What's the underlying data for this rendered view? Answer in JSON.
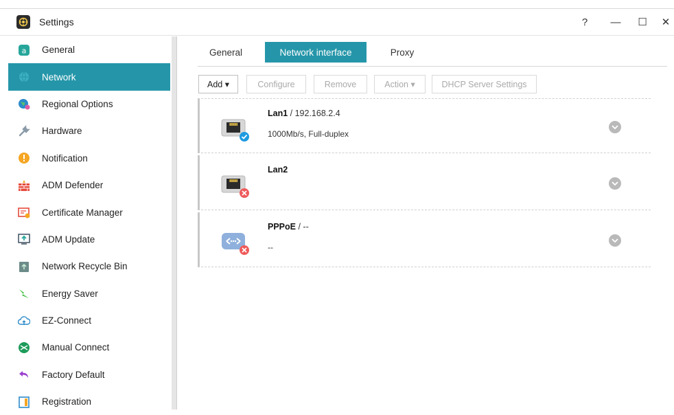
{
  "window": {
    "title": "Settings",
    "controls": {
      "help": "?",
      "minimize": "—",
      "maximize": "☐",
      "close": "✕"
    }
  },
  "sidebar": {
    "items": [
      {
        "label": "General",
        "icon": "general-icon",
        "active": false
      },
      {
        "label": "Network",
        "icon": "network-icon",
        "active": true
      },
      {
        "label": "Regional Options",
        "icon": "globe-icon",
        "active": false
      },
      {
        "label": "Hardware",
        "icon": "wrench-icon",
        "active": false
      },
      {
        "label": "Notification",
        "icon": "alert-icon",
        "active": false
      },
      {
        "label": "ADM Defender",
        "icon": "firewall-icon",
        "active": false
      },
      {
        "label": "Certificate Manager",
        "icon": "certificate-icon",
        "active": false
      },
      {
        "label": "ADM Update",
        "icon": "update-icon",
        "active": false
      },
      {
        "label": "Network Recycle Bin",
        "icon": "recycle-bin-icon",
        "active": false
      },
      {
        "label": "Energy Saver",
        "icon": "energy-icon",
        "active": false
      },
      {
        "label": "EZ-Connect",
        "icon": "cloud-icon",
        "active": false
      },
      {
        "label": "Manual Connect",
        "icon": "manual-connect-icon",
        "active": false
      },
      {
        "label": "Factory Default",
        "icon": "reset-icon",
        "active": false
      },
      {
        "label": "Registration",
        "icon": "registration-icon",
        "active": false
      }
    ]
  },
  "tabs": [
    {
      "label": "General",
      "active": false
    },
    {
      "label": "Network interface",
      "active": true
    },
    {
      "label": "Proxy",
      "active": false
    }
  ],
  "toolbar": {
    "add": "Add ▾",
    "configure": "Configure",
    "remove": "Remove",
    "action": "Action ▾",
    "dhcp": "DHCP Server Settings"
  },
  "interfaces": [
    {
      "name": "Lan1",
      "ip": " / 192.168.2.4",
      "detail": "1000Mb/s, Full-duplex",
      "status": "connected",
      "icon": "ethernet-port-icon"
    },
    {
      "name": "Lan2",
      "ip": "",
      "detail": "",
      "status": "disconnected",
      "icon": "ethernet-port-icon"
    },
    {
      "name": "PPPoE",
      "ip": " / --",
      "detail": "--",
      "status": "disconnected",
      "icon": "pppoe-icon"
    }
  ],
  "colors": {
    "accent": "#2596a9",
    "ok": "#1e9be0",
    "error": "#ef5b5b"
  }
}
